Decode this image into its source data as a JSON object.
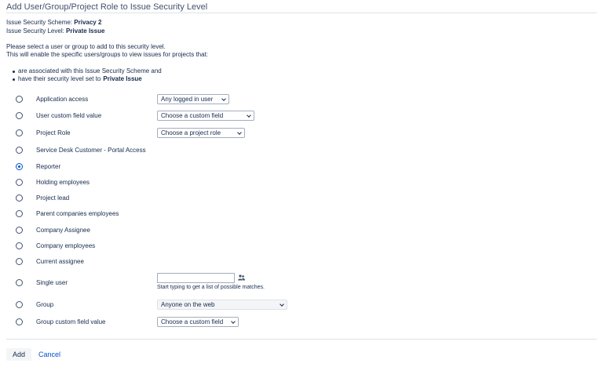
{
  "page": {
    "title": "Add User/Group/Project Role to Issue Security Level"
  },
  "meta": {
    "scheme_label": "Issue Security Scheme:",
    "scheme_value": "Privacy 2",
    "level_label": "Issue Security Level:",
    "level_value": "Private Issue"
  },
  "intro": {
    "line1": "Please select a user or group to add to this security level.",
    "line2": "This will enable the specific users/groups to view issues for projects that:",
    "bullet1": "are associated with this Issue Security Scheme and",
    "bullet2_prefix": "have their security level set to",
    "bullet2_value": "Private Issue"
  },
  "options": [
    {
      "label": "Application access",
      "checked": false
    },
    {
      "label": "User custom field value",
      "checked": false
    },
    {
      "label": "Project Role",
      "checked": false
    },
    {
      "label": "Service Desk Customer - Portal Access",
      "checked": false
    },
    {
      "label": "Reporter",
      "checked": true
    },
    {
      "label": "Holding employees",
      "checked": false
    },
    {
      "label": "Project lead",
      "checked": false
    },
    {
      "label": "Parent companies employees",
      "checked": false
    },
    {
      "label": "Company Assignee",
      "checked": false
    },
    {
      "label": "Company employees",
      "checked": false
    },
    {
      "label": "Current assignee",
      "checked": false
    },
    {
      "label": "Single user",
      "checked": false
    },
    {
      "label": "Group",
      "checked": false
    },
    {
      "label": "Group custom field value",
      "checked": false
    }
  ],
  "selects": {
    "application_access": "Any logged in user",
    "user_custom_field": "Choose a custom field",
    "project_role": "Choose a project role",
    "group": "Anyone on the web",
    "group_custom_field": "Choose a custom field"
  },
  "single_user": {
    "value": "",
    "hint": "Start typing to get a list of possible matches.",
    "icon": "users-icon"
  },
  "footer": {
    "add_label": "Add",
    "cancel_label": "Cancel"
  },
  "colors": {
    "accent": "#0052cc",
    "text": "#172b4d",
    "border": "#dfe1e6"
  }
}
